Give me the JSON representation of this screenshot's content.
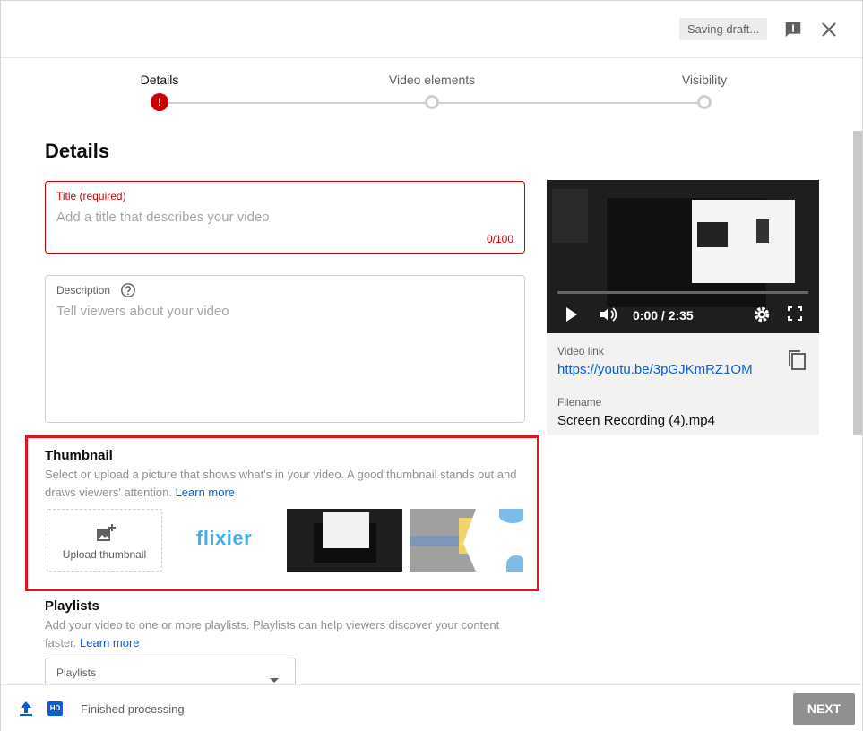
{
  "header": {
    "saving_label": "Saving draft...",
    "feedback_icon": "feedback-icon",
    "close_icon": "close-icon"
  },
  "stepper": {
    "steps": [
      {
        "label": "Details",
        "state": "error"
      },
      {
        "label": "Video elements",
        "state": "pending"
      },
      {
        "label": "Visibility",
        "state": "pending"
      }
    ]
  },
  "details": {
    "heading": "Details",
    "title_field": {
      "label": "Title (required)",
      "placeholder": "Add a title that describes your video",
      "value": "",
      "counter": "0/100"
    },
    "description_field": {
      "label": "Description",
      "placeholder": "Tell viewers about your video",
      "value": ""
    }
  },
  "preview": {
    "time": "0:00 / 2:35",
    "video_link_label": "Video link",
    "video_link": "https://youtu.be/3pGJKmRZ1OM",
    "filename_label": "Filename",
    "filename": "Screen Recording (4).mp4"
  },
  "thumbnail": {
    "title": "Thumbnail",
    "description": "Select or upload a picture that shows what's in your video. A good thumbnail stands out and draws viewers' attention.",
    "learn_more": "Learn more",
    "upload_label": "Upload thumbnail",
    "flixier_logo": "flixier",
    "highlight_color": "#e0141e"
  },
  "playlists": {
    "title": "Playlists",
    "description": "Add your video to one or more playlists. Playlists can help viewers discover your content faster.",
    "learn_more": "Learn more",
    "select_label": "Playlists"
  },
  "footer": {
    "hd_badge": "HD",
    "status": "Finished processing",
    "next_label": "NEXT"
  },
  "colors": {
    "error": "#cc0000",
    "link": "#065fd4",
    "next_disabled": "#909090"
  }
}
